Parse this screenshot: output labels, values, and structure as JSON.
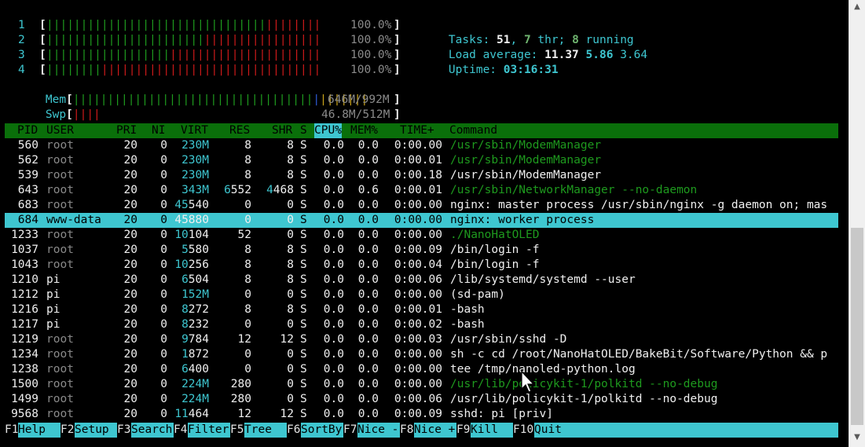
{
  "meters": {
    "cpus": [
      {
        "label": "1",
        "pct": "100.0%",
        "green": 32,
        "red": 8,
        "frac": 1.0
      },
      {
        "label": "2",
        "pct": "100.0%",
        "green": 23,
        "red": 17,
        "frac": 1.0
      },
      {
        "label": "3",
        "pct": "100.0%",
        "green": 18,
        "red": 22,
        "frac": 1.0
      },
      {
        "label": "4",
        "pct": "100.0%",
        "green": 8,
        "red": 32,
        "frac": 1.0
      }
    ],
    "mem": {
      "label": "Mem",
      "value": "646M/992M"
    },
    "swp": {
      "label": "Swp",
      "value": "46.8M/512M"
    }
  },
  "summary": {
    "tasks_label": "Tasks: ",
    "tasks_count": "51",
    "sep1": ", ",
    "thr_count": "7",
    "thr_label": " thr; ",
    "running_count": "8",
    "running_label": " running",
    "load_label": "Load average: ",
    "load1": "11.37",
    "load5": "5.86",
    "load15": "3.64",
    "uptime_label": "Uptime: ",
    "uptime": "03:16:31"
  },
  "table": {
    "headers": {
      "pid": "PID",
      "user": "USER",
      "pri": "PRI",
      "ni": "NI",
      "virt": "VIRT",
      "res": "RES",
      "shr": "SHR",
      "s": "S",
      "cpu": "CPU%",
      "mem": "MEM%",
      "time": "TIME+",
      "command": "Command"
    },
    "rows": [
      {
        "pid": "560",
        "user": "root",
        "pri": "20",
        "ni": "0",
        "virt_hi": "",
        "virt": "230M",
        "res_hi": "",
        "res": "8",
        "shr_hi": "",
        "shr": "8",
        "s": "S",
        "cpu": "0.0",
        "mem": "0.0",
        "time": "0:00.00",
        "command": "/usr/sbin/ModemManager",
        "thread": true,
        "virt_c": true
      },
      {
        "pid": "562",
        "user": "root",
        "pri": "20",
        "ni": "0",
        "virt_hi": "",
        "virt": "230M",
        "res_hi": "",
        "res": "8",
        "shr_hi": "",
        "shr": "8",
        "s": "S",
        "cpu": "0.0",
        "mem": "0.0",
        "time": "0:00.01",
        "command": "/usr/sbin/ModemManager",
        "thread": true,
        "virt_c": true
      },
      {
        "pid": "539",
        "user": "root",
        "pri": "20",
        "ni": "0",
        "virt_hi": "",
        "virt": "230M",
        "res_hi": "",
        "res": "8",
        "shr_hi": "",
        "shr": "8",
        "s": "S",
        "cpu": "0.0",
        "mem": "0.0",
        "time": "0:00.18",
        "command": "/usr/sbin/ModemManager",
        "thread": false,
        "virt_c": true
      },
      {
        "pid": "643",
        "user": "root",
        "pri": "20",
        "ni": "0",
        "virt_hi": "",
        "virt": "343M",
        "res_hi": "6",
        "res": "552",
        "shr_hi": "4",
        "shr": "468",
        "s": "S",
        "cpu": "0.0",
        "mem": "0.6",
        "time": "0:00.01",
        "command": "/usr/sbin/NetworkManager --no-daemon",
        "thread": true,
        "virt_c": true
      },
      {
        "pid": "683",
        "user": "root",
        "pri": "20",
        "ni": "0",
        "virt_hi": "45",
        "virt": "540",
        "res_hi": "",
        "res": "0",
        "shr_hi": "",
        "shr": "0",
        "s": "S",
        "cpu": "0.0",
        "mem": "0.0",
        "time": "0:00.00",
        "command": "nginx: master process /usr/sbin/nginx -g daemon on; mas",
        "thread": false,
        "virt_c": false
      },
      {
        "pid": "684",
        "user": "www-data",
        "pri": "20",
        "ni": "0",
        "virt_hi": "",
        "virt": "45880",
        "res_hi": "",
        "res": "0",
        "shr_hi": "",
        "shr": "0",
        "s": "S",
        "cpu": "0.0",
        "mem": "0.0",
        "time": "0:00.00",
        "command": "nginx: worker process",
        "thread": false,
        "virt_c": false,
        "selected": true
      },
      {
        "pid": "1233",
        "user": "root",
        "pri": "20",
        "ni": "0",
        "virt_hi": "10",
        "virt": "104",
        "res_hi": "",
        "res": "52",
        "shr_hi": "",
        "shr": "0",
        "s": "S",
        "cpu": "0.0",
        "mem": "0.0",
        "time": "0:00.00",
        "command": "./NanoHatOLED",
        "thread": true,
        "virt_c": false
      },
      {
        "pid": "1037",
        "user": "root",
        "pri": "20",
        "ni": "0",
        "virt_hi": "5",
        "virt": "580",
        "res_hi": "",
        "res": "8",
        "shr_hi": "",
        "shr": "8",
        "s": "S",
        "cpu": "0.0",
        "mem": "0.0",
        "time": "0:00.09",
        "command": "/bin/login -f",
        "thread": false,
        "virt_c": false
      },
      {
        "pid": "1043",
        "user": "root",
        "pri": "20",
        "ni": "0",
        "virt_hi": "10",
        "virt": "256",
        "res_hi": "",
        "res": "8",
        "shr_hi": "",
        "shr": "8",
        "s": "S",
        "cpu": "0.0",
        "mem": "0.0",
        "time": "0:00.04",
        "command": "/bin/login -f",
        "thread": false,
        "virt_c": false
      },
      {
        "pid": "1210",
        "user": "pi",
        "pri": "20",
        "ni": "0",
        "virt_hi": "6",
        "virt": "504",
        "res_hi": "",
        "res": "8",
        "shr_hi": "",
        "shr": "8",
        "s": "S",
        "cpu": "0.0",
        "mem": "0.0",
        "time": "0:00.06",
        "command": "/lib/systemd/systemd --user",
        "thread": false,
        "virt_c": false
      },
      {
        "pid": "1212",
        "user": "pi",
        "pri": "20",
        "ni": "0",
        "virt_hi": "",
        "virt": "152M",
        "res_hi": "",
        "res": "0",
        "shr_hi": "",
        "shr": "0",
        "s": "S",
        "cpu": "0.0",
        "mem": "0.0",
        "time": "0:00.00",
        "command": "(sd-pam)",
        "thread": false,
        "virt_c": true
      },
      {
        "pid": "1216",
        "user": "pi",
        "pri": "20",
        "ni": "0",
        "virt_hi": "8",
        "virt": "272",
        "res_hi": "",
        "res": "8",
        "shr_hi": "",
        "shr": "8",
        "s": "S",
        "cpu": "0.0",
        "mem": "0.0",
        "time": "0:00.01",
        "command": "-bash",
        "thread": false,
        "virt_c": false
      },
      {
        "pid": "1217",
        "user": "pi",
        "pri": "20",
        "ni": "0",
        "virt_hi": "8",
        "virt": "232",
        "res_hi": "",
        "res": "0",
        "shr_hi": "",
        "shr": "0",
        "s": "S",
        "cpu": "0.0",
        "mem": "0.0",
        "time": "0:00.02",
        "command": "-bash",
        "thread": false,
        "virt_c": false
      },
      {
        "pid": "1219",
        "user": "root",
        "pri": "20",
        "ni": "0",
        "virt_hi": "9",
        "virt": "784",
        "res_hi": "",
        "res": "12",
        "shr_hi": "",
        "shr": "12",
        "s": "S",
        "cpu": "0.0",
        "mem": "0.0",
        "time": "0:00.03",
        "command": "/usr/sbin/sshd -D",
        "thread": false,
        "virt_c": false
      },
      {
        "pid": "1234",
        "user": "root",
        "pri": "20",
        "ni": "0",
        "virt_hi": "1",
        "virt": "872",
        "res_hi": "",
        "res": "0",
        "shr_hi": "",
        "shr": "0",
        "s": "S",
        "cpu": "0.0",
        "mem": "0.0",
        "time": "0:00.00",
        "command": "sh -c cd /root/NanoHatOLED/BakeBit/Software/Python && p",
        "thread": false,
        "virt_c": false
      },
      {
        "pid": "1238",
        "user": "root",
        "pri": "20",
        "ni": "0",
        "virt_hi": "6",
        "virt": "400",
        "res_hi": "",
        "res": "0",
        "shr_hi": "",
        "shr": "0",
        "s": "S",
        "cpu": "0.0",
        "mem": "0.0",
        "time": "0:00.00",
        "command": "tee /tmp/nanoled-python.log",
        "thread": false,
        "virt_c": false
      },
      {
        "pid": "1500",
        "user": "root",
        "pri": "20",
        "ni": "0",
        "virt_hi": "",
        "virt": "224M",
        "res_hi": "",
        "res": "280",
        "shr_hi": "",
        "shr": "0",
        "s": "S",
        "cpu": "0.0",
        "mem": "0.0",
        "time": "0:00.00",
        "command": "/usr/lib/policykit-1/polkitd --no-debug",
        "thread": true,
        "virt_c": true
      },
      {
        "pid": "1499",
        "user": "root",
        "pri": "20",
        "ni": "0",
        "virt_hi": "",
        "virt": "224M",
        "res_hi": "",
        "res": "280",
        "shr_hi": "",
        "shr": "0",
        "s": "S",
        "cpu": "0.0",
        "mem": "0.0",
        "time": "0:00.06",
        "command": "/usr/lib/policykit-1/polkitd --no-debug",
        "thread": false,
        "virt_c": true
      },
      {
        "pid": "9568",
        "user": "root",
        "pri": "20",
        "ni": "0",
        "virt_hi": "11",
        "virt": "464",
        "res_hi": "",
        "res": "12",
        "shr_hi": "",
        "shr": "12",
        "s": "S",
        "cpu": "0.0",
        "mem": "0.0",
        "time": "0:00.09",
        "command": "sshd: pi [priv]",
        "thread": false,
        "virt_c": false
      }
    ]
  },
  "footer": [
    {
      "key": "F1",
      "label": "Help  "
    },
    {
      "key": "F2",
      "label": "Setup "
    },
    {
      "key": "F3",
      "label": "Search"
    },
    {
      "key": "F4",
      "label": "Filter"
    },
    {
      "key": "F5",
      "label": "Tree  "
    },
    {
      "key": "F6",
      "label": "SortBy"
    },
    {
      "key": "F7",
      "label": "Nice -"
    },
    {
      "key": "F8",
      "label": "Nice +"
    },
    {
      "key": "F9",
      "label": "Kill  "
    },
    {
      "key": "F10",
      "label": "Quit  "
    }
  ],
  "colors": {
    "header_bg": "#0a6f0a",
    "highlight": "#3ec6d0",
    "green": "#1e9a1e",
    "red": "#cc1a1a"
  }
}
